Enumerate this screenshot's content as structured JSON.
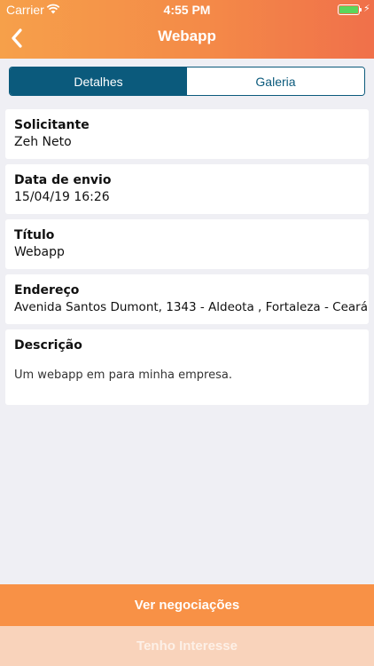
{
  "status_bar": {
    "carrier": "Carrier",
    "time": "4:55 PM",
    "wifi_icon": "wifi-icon",
    "battery_icon": "battery-icon",
    "charging_icon": "charging-bolt-icon"
  },
  "nav": {
    "title": "Webapp",
    "back_icon": "chevron-left-icon"
  },
  "tabs": [
    {
      "label": "Detalhes",
      "selected": true
    },
    {
      "label": "Galeria",
      "selected": false
    }
  ],
  "details": [
    {
      "label": "Solicitante",
      "value": "Zeh Neto"
    },
    {
      "label": "Data de envio",
      "value": "15/04/19 16:26"
    },
    {
      "label": "Título",
      "value": "Webapp"
    },
    {
      "label": "Endereço",
      "value": "Avenida Santos Dumont, 1343 - Aldeota , Fortaleza - Ceará"
    },
    {
      "label": "Descrição",
      "value": "Um webapp em para minha empresa."
    }
  ],
  "actions": {
    "primary_label": "Ver negociações",
    "secondary_label": "Tenho Interesse"
  },
  "colors": {
    "header_gradient_start": "#f6a04a",
    "header_gradient_end": "#f0704a",
    "segment_accent": "#0b5a7c",
    "primary_button": "#f89146",
    "secondary_button": "#f9d3bb",
    "background": "#efeff4"
  }
}
